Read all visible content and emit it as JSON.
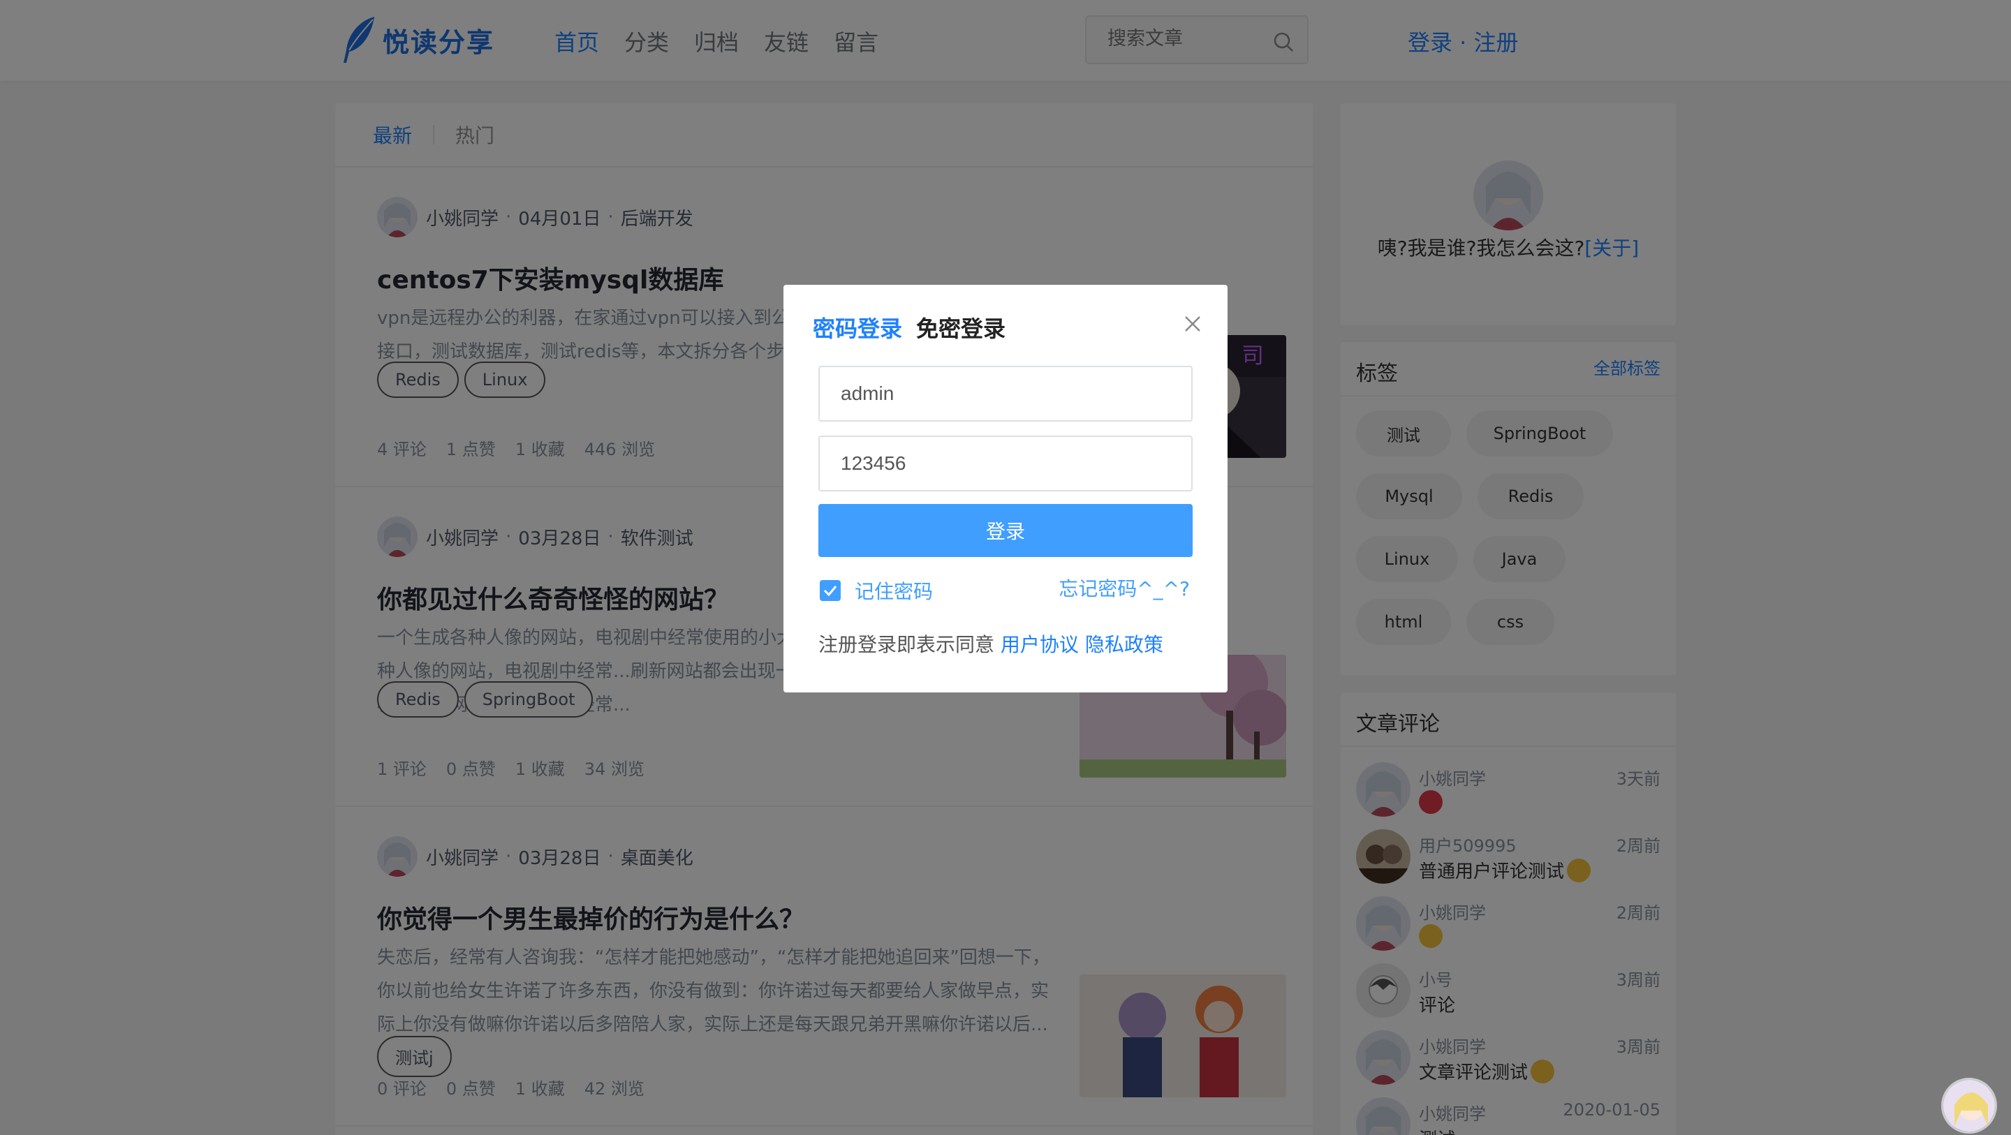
{
  "header": {
    "logo_text": "悦读分享",
    "nav": [
      "首页",
      "分类",
      "归档",
      "友链",
      "留言"
    ],
    "search_placeholder": "搜索文章",
    "login_text": "登录 · 注册"
  },
  "feed": {
    "tabs": [
      "最新",
      "热门"
    ],
    "articles": [
      {
        "author": "小姚同学",
        "date": "04月01日",
        "category": "后端开发",
        "title": "centos7下安装mysql数据库",
        "summary": "vpn是远程办公的利器，在家通过vpn可以接入到公司的内网环境，比如测试环境的接口，测试数据库，测试redis等，本文拆分各个步骤进行讲解...",
        "tags": [
          "Redis",
          "Linux"
        ],
        "comments": "4 评论",
        "likes": "1 点赞",
        "favorites": "1 收藏",
        "views": "446 浏览"
      },
      {
        "author": "小姚同学",
        "date": "03月28日",
        "category": "软件测试",
        "title": "你都见过什么奇奇怪怪的网站？",
        "summary": "一个生成各种人像的网站，电视剧中经常使用的小大个人脸，各种各样：一个生成各种人像的网站，电视剧中经常...刷新网站都会出现一个人脸，各种各样：一个生成各种人像的网站，电视剧中经常...",
        "tags": [
          "Redis",
          "SpringBoot"
        ],
        "comments": "1 评论",
        "likes": "0 点赞",
        "favorites": "1 收藏",
        "views": "34 浏览"
      },
      {
        "author": "小姚同学",
        "date": "03月28日",
        "category": "桌面美化",
        "title": "你觉得一个男生最掉价的行为是什么？",
        "summary": "失恋后，经常有人咨询我：“怎样才能把她感动”，“怎样才能把她追回来”回想一下，你以前也给女生许诺了许多东西，你没有做到：你许诺过每天都要给人家做早点，实际上你没有做嘛你许诺以后多陪陪人家，实际上还是每天跟兄弟开黑嘛你许诺以后...",
        "tags": [
          "测试j"
        ],
        "comments": "0 评论",
        "likes": "0 点赞",
        "favorites": "1 收藏",
        "views": "42 浏览"
      }
    ]
  },
  "sidebar": {
    "profile_text": "咦?我是谁?我怎么会这?",
    "profile_about": "[关于]",
    "tags_title": "标签",
    "tags_all": "全部标签",
    "tags": [
      "测试",
      "SpringBoot",
      "Mysql",
      "Redis",
      "Linux",
      "Java",
      "html",
      "css"
    ],
    "comments_title": "文章评论",
    "comments": [
      {
        "user": "小姚同学",
        "time": "3天前",
        "text": ""
      },
      {
        "user": "用户509995",
        "time": "2周前",
        "text": "普通用户评论测试"
      },
      {
        "user": "小姚同学",
        "time": "2周前",
        "text": ""
      },
      {
        "user": "小号",
        "time": "3周前",
        "text": "评论"
      },
      {
        "user": "小姚同学",
        "time": "3周前",
        "text": "文章评论测试"
      },
      {
        "user": "小姚同学",
        "time": "2020-01-05",
        "text": "测试"
      }
    ]
  },
  "modal": {
    "tab_password": "密码登录",
    "tab_code": "免密登录",
    "username_value": "admin",
    "password_value": "123456",
    "submit": "登录",
    "remember": "记住密码",
    "forgot": "忘记密码^_^?",
    "agree_prefix": "注册登录即表示同意",
    "agreement": "用户协议",
    "privacy": "隐私政策"
  },
  "colors": {
    "accent": "#1e80ff",
    "button": "#409eff",
    "overlay": "rgba(0,0,0,0.5)"
  }
}
